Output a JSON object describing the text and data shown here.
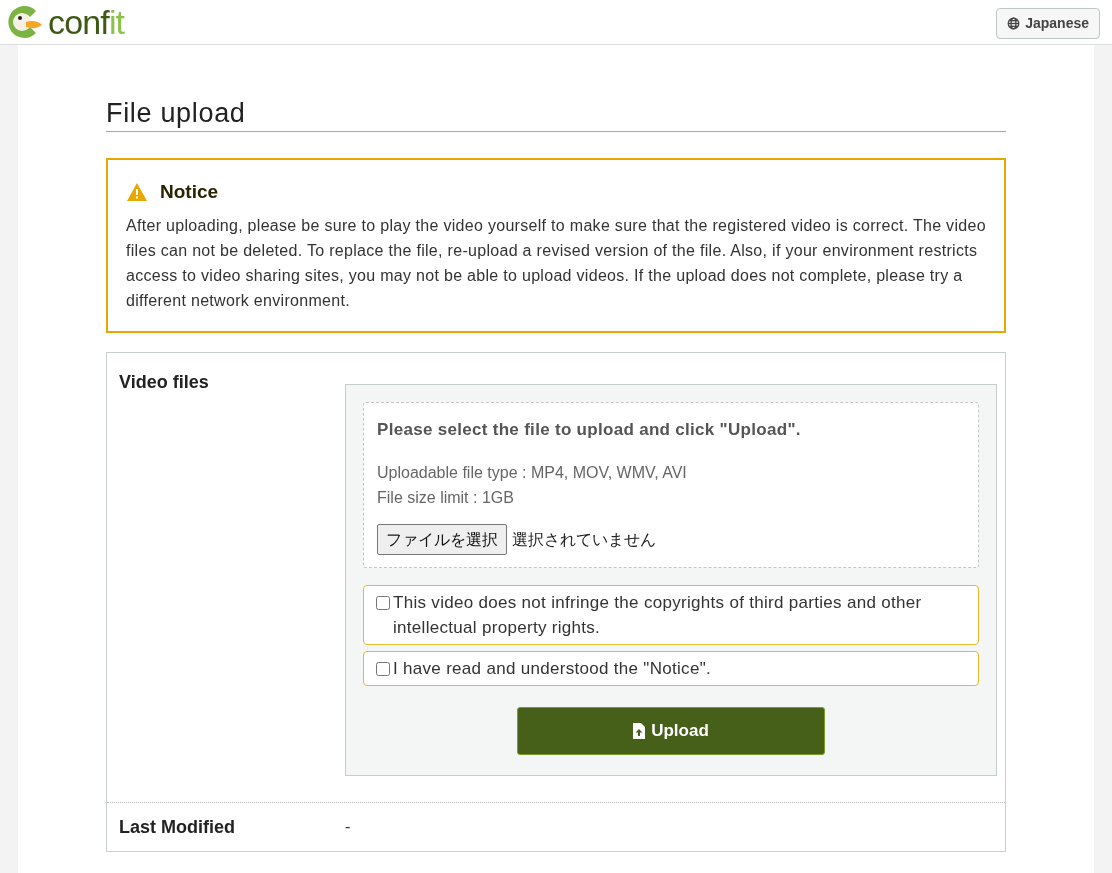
{
  "header": {
    "logo": "confit",
    "language_button": "Japanese"
  },
  "page_title": "File upload",
  "notice": {
    "title": "Notice",
    "text": "After uploading, please be sure to play the video yourself to make sure that the registered video is correct. The video files can not be deleted. To replace the file, re-upload a revised version of the file. Also, if your environment restricts access to video sharing sites, you may not be able to upload videos. If the upload does not complete, please try a different network environment."
  },
  "form": {
    "video_files": {
      "label": "Video files",
      "instruction": "Please select the file to upload and click \"Upload\".",
      "file_types": "Uploadable file type : MP4, MOV, WMV, AVI",
      "size_limit": "File size limit : 1GB",
      "choose_button": "ファイルを選択",
      "file_status": "選択されていません",
      "agreements": [
        {
          "label": "This video does not infringe the copyrights of third parties and other intellectual property rights.",
          "checked": false
        },
        {
          "label": "I have read and understood the \"Notice\".",
          "checked": false
        }
      ],
      "upload_button": "Upload"
    },
    "last_modified": {
      "label": "Last Modified",
      "value": "-"
    }
  }
}
